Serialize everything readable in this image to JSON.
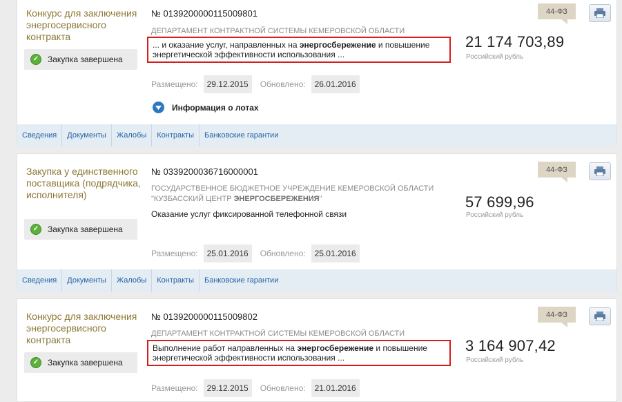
{
  "cards": [
    {
      "type_title": "Конкурс для заключения энергосервисного контракта",
      "status": "Закупка завершена",
      "number": "№ 0139200000115009801",
      "org_html": "ДЕПАРТАМЕНТ КОНТРАКТНОЙ СИСТЕМЫ КЕМЕРОВСКОЙ ОБЛАСТИ",
      "desc_parts": [
        "... и оказание услуг, направленных на ",
        "энергосбережение",
        " и повышение энергетической эффективности использования ..."
      ],
      "price": "21 174 703,89",
      "currency": "Российский рубль",
      "law": "44-ФЗ",
      "posted_label": "Размещено:",
      "posted": "29.12.2015",
      "updated_label": "Обновлено:",
      "updated": "26.01.2016",
      "lots_label": "Информация о лотах",
      "tabs": [
        "Сведения",
        "Документы",
        "Жалобы",
        "Контракты",
        "Банковские гарантии"
      ]
    },
    {
      "type_title": "Закупка у единственного поставщика (подрядчика, исполнителя)",
      "status": "Закупка завершена",
      "number": "№ 0339200036716000001",
      "org_parts": [
        "ГОСУДАРСТВЕННОЕ БЮДЖЕТНОЕ УЧРЕЖДЕНИЕ КЕМЕРОВСКОЙ ОБЛАСТИ \"КУЗБАССКИЙ ЦЕНТР ",
        "ЭНЕРГОСБЕРЕЖЕНИЯ",
        "\""
      ],
      "desc": "Оказание услуг фиксированной телефонной связи",
      "price": "57 699,96",
      "currency": "Российский рубль",
      "law": "44-ФЗ",
      "posted_label": "Размещено:",
      "posted": "25.01.2016",
      "updated_label": "Обновлено:",
      "updated": "25.01.2016",
      "tabs": [
        "Сведения",
        "Документы",
        "Жалобы",
        "Контракты",
        "Банковские гарантии"
      ]
    },
    {
      "type_title": "Конкурс для заключения энергосервисного контракта",
      "status": "Закупка завершена",
      "number": "№ 0139200000115009802",
      "org_html": "ДЕПАРТАМЕНТ КОНТРАКТНОЙ СИСТЕМЫ КЕМЕРОВСКОЙ ОБЛАСТИ",
      "desc_parts": [
        "Выполнение работ направленных на ",
        "энергосбережение",
        " и повышение энергетической эффективности использования ..."
      ],
      "price": "3 164 907,42",
      "currency": "Российский рубль",
      "law": "44-ФЗ",
      "posted_label": "Размещено:",
      "posted": "29.12.2015",
      "updated_label": "Обновлено:",
      "updated": "21.01.2016"
    }
  ],
  "colors": {
    "title": "#8b7a36",
    "highlight_border": "#d51e1e",
    "link": "#2563a6",
    "tabs_bg": "#e4edf4"
  },
  "icons": {
    "status": "check-circle-icon",
    "print": "printer-icon",
    "lots": "chevron-down-circle-icon"
  }
}
